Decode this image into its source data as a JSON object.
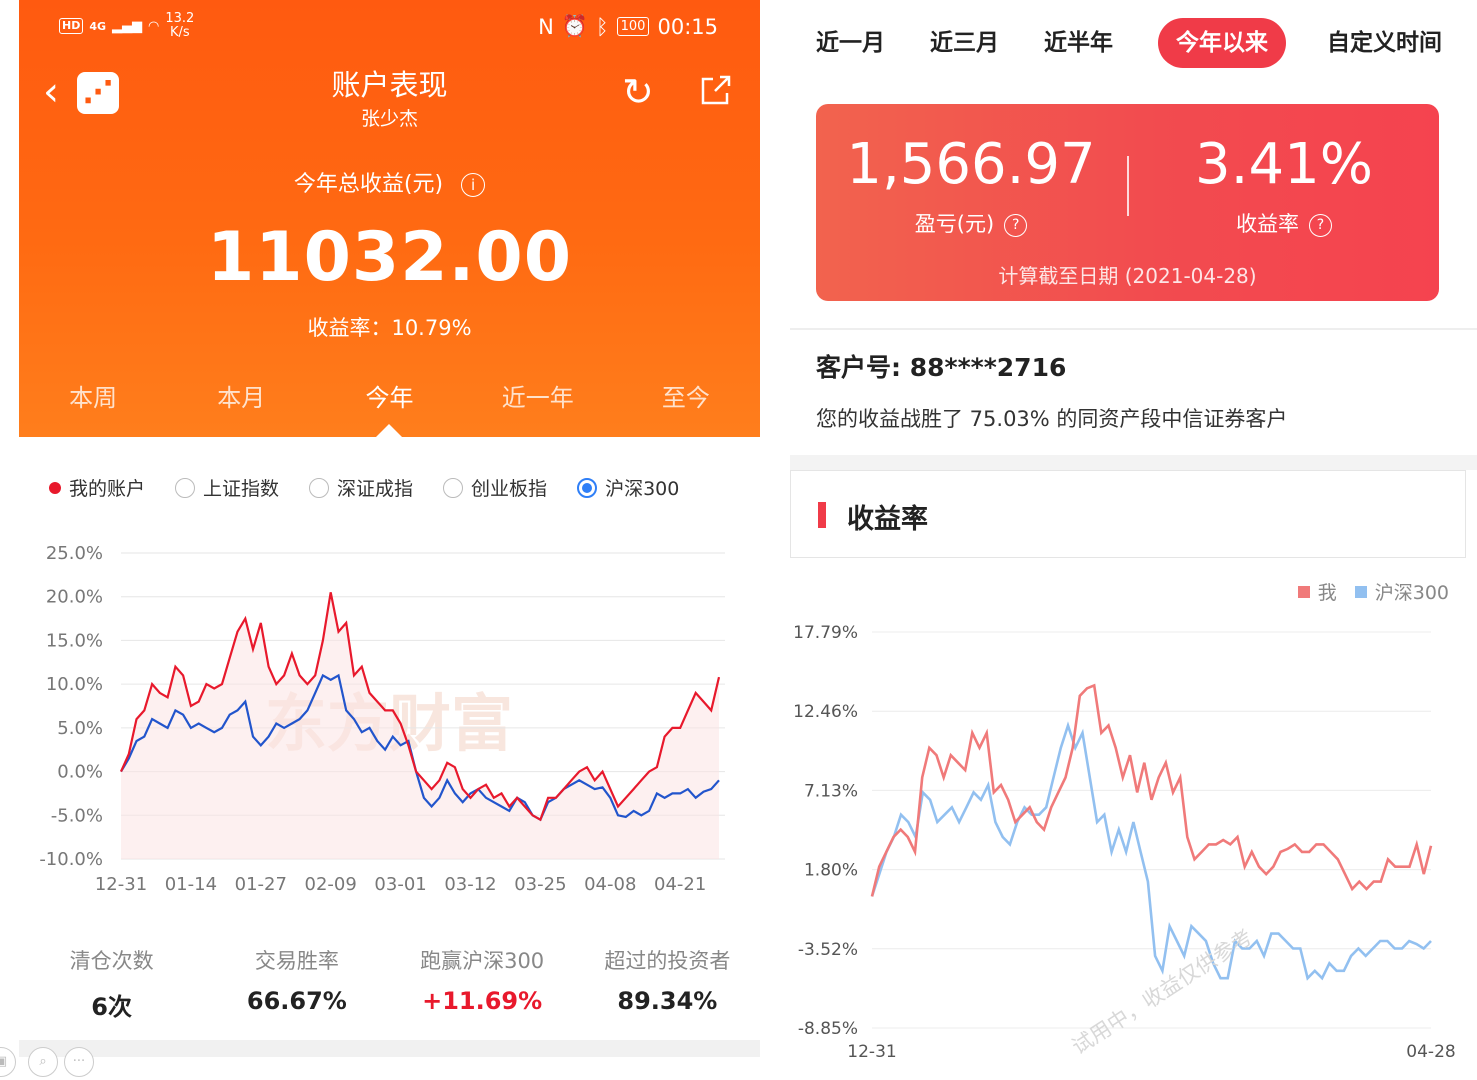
{
  "status_bar": {
    "left_badges": [
      "HD",
      "4G"
    ],
    "speed": "13.2",
    "speed_unit": "K/s",
    "battery": "100",
    "time": "00:15"
  },
  "left": {
    "header": {
      "title": "账户表现",
      "subtitle": "张少杰",
      "total_label": "今年总收益(元)",
      "total_value": "11032.00",
      "rate_text": "收益率：10.79%",
      "info_icon": "i"
    },
    "period_tabs": [
      {
        "label": "本周",
        "active": false
      },
      {
        "label": "本月",
        "active": false
      },
      {
        "label": "今年",
        "active": true
      },
      {
        "label": "近一年",
        "active": false
      },
      {
        "label": "至今",
        "active": false
      }
    ],
    "legend": [
      {
        "label": "我的账户",
        "type": "dot",
        "color": "#e8192c"
      },
      {
        "label": "上证指数",
        "type": "radio",
        "checked": false
      },
      {
        "label": "深证成指",
        "type": "radio",
        "checked": false
      },
      {
        "label": "创业板指",
        "type": "radio",
        "checked": false
      },
      {
        "label": "沪深300",
        "type": "radio",
        "checked": true
      }
    ],
    "watermark": "东方财富",
    "stats": [
      {
        "label": "清仓次数",
        "value": "6次",
        "highlight": false
      },
      {
        "label": "交易胜率",
        "value": "66.67%",
        "highlight": false
      },
      {
        "label": "跑赢沪深300",
        "value": "+11.69%",
        "highlight": true
      },
      {
        "label": "超过的投资者",
        "value": "89.34%",
        "highlight": false
      }
    ]
  },
  "right": {
    "tabs": [
      {
        "label": "近一月",
        "active": false
      },
      {
        "label": "近三月",
        "active": false
      },
      {
        "label": "近半年",
        "active": false
      },
      {
        "label": "今年以来",
        "active": true
      },
      {
        "label": "自定义时间",
        "active": false
      }
    ],
    "card": {
      "profit_value": "1,566.97",
      "profit_label": "盈亏(元)",
      "rate_value": "3.41%",
      "rate_label": "收益率",
      "help_icon": "?",
      "date_text": "计算截至日期 (2021-04-28)"
    },
    "customer": "客户号: 88****2716",
    "beat_text": "您的收益战胜了 75.03% 的同资产段中信证券客户",
    "section_title": "收益率",
    "legend": [
      {
        "label": "我",
        "color": "#f07a7a"
      },
      {
        "label": "沪深300",
        "color": "#92c0f0"
      }
    ],
    "watermark": "试用中，收益仅供参考"
  },
  "chart_data": [
    {
      "type": "line",
      "title": "",
      "x": [
        "12-31",
        "01-04",
        "01-05",
        "01-06",
        "01-07",
        "01-08",
        "01-11",
        "01-12",
        "01-13",
        "01-14",
        "01-15",
        "01-18",
        "01-19",
        "01-20",
        "01-21",
        "01-22",
        "01-25",
        "01-26",
        "01-27",
        "01-28",
        "01-29",
        "02-01",
        "02-02",
        "02-03",
        "02-04",
        "02-05",
        "02-08",
        "02-09",
        "02-10",
        "02-18",
        "02-19",
        "02-22",
        "02-23",
        "02-24",
        "02-25",
        "02-26",
        "03-01",
        "03-02",
        "03-03",
        "03-04",
        "03-05",
        "03-08",
        "03-09",
        "03-10",
        "03-11",
        "03-12",
        "03-15",
        "03-16",
        "03-17",
        "03-18",
        "03-19",
        "03-22",
        "03-23",
        "03-24",
        "03-25",
        "03-26",
        "03-29",
        "03-30",
        "03-31",
        "04-01",
        "04-02",
        "04-06",
        "04-07",
        "04-08",
        "04-09",
        "04-12",
        "04-13",
        "04-14",
        "04-15",
        "04-16",
        "04-19",
        "04-20",
        "04-21",
        "04-22",
        "04-23",
        "04-26",
        "04-27",
        "04-28"
      ],
      "xticks": [
        "12-31",
        "01-14",
        "01-27",
        "02-09",
        "03-01",
        "03-12",
        "03-25",
        "04-08",
        "04-21"
      ],
      "ylim": [
        -10,
        25
      ],
      "yticks": [
        "25.0%",
        "20.0%",
        "15.0%",
        "10.0%",
        "5.0%",
        "0.0%",
        "-5.0%",
        "-10.0%"
      ],
      "series": [
        {
          "name": "我的账户",
          "color": "#e8192c",
          "values": [
            0,
            2,
            6,
            7,
            10,
            9,
            8.5,
            12,
            11,
            7.5,
            8,
            10,
            9.5,
            10,
            13,
            16,
            17.5,
            14,
            17,
            12,
            10,
            11,
            13.5,
            11,
            10,
            11,
            15,
            20.5,
            16,
            17,
            11,
            12,
            9,
            8,
            7,
            7,
            5.5,
            3,
            0,
            -1,
            -2,
            -1,
            1,
            0.5,
            -2,
            -3,
            -2,
            -1.5,
            -3,
            -2.5,
            -4,
            -3,
            -4,
            -5,
            -5.5,
            -3,
            -3,
            -2,
            -1,
            0,
            0.5,
            -1,
            0,
            -2,
            -4,
            -3,
            -2,
            -1,
            0,
            0.5,
            4,
            5,
            5,
            7,
            9,
            8,
            7,
            10.8
          ]
        },
        {
          "name": "沪深300",
          "color": "#2255cc",
          "values": [
            0,
            1.5,
            3.5,
            4,
            6,
            5.5,
            5,
            7,
            6.5,
            5,
            5.5,
            5,
            4.5,
            5,
            6.5,
            7,
            8,
            4,
            3,
            4,
            5.5,
            5,
            5.5,
            6,
            7,
            9,
            11,
            10.5,
            11,
            7,
            6,
            4.5,
            5,
            3.5,
            2.5,
            4,
            3,
            3.5,
            0,
            -3,
            -4,
            -3,
            -1,
            -2.5,
            -3.5,
            -2.5,
            -2,
            -3,
            -3.5,
            -4,
            -4.5,
            -3,
            -3.5,
            -5,
            -5.5,
            -3.5,
            -3,
            -2,
            -1.5,
            -1,
            -1.5,
            -2,
            -1.8,
            -3,
            -5,
            -5.2,
            -4.5,
            -5,
            -4.5,
            -2.5,
            -3,
            -2.5,
            -2.5,
            -2,
            -3,
            -2.3,
            -2,
            -1
          ]
        }
      ]
    },
    {
      "type": "line",
      "title": "收益率",
      "xlabels": [
        "12-31",
        "04-28"
      ],
      "ylim": [
        -8.85,
        17.79
      ],
      "yticks": [
        "17.79%",
        "12.46%",
        "7.13%",
        "1.80%",
        "-3.52%",
        "-8.85%"
      ],
      "series": [
        {
          "name": "我",
          "color": "#f07a7a",
          "values": [
            0,
            2,
            3,
            4,
            4.5,
            4,
            3,
            8,
            10,
            9.5,
            8,
            9.5,
            9,
            8.5,
            11,
            10,
            11,
            7,
            7.5,
            6.5,
            5,
            5.5,
            6,
            5,
            4.5,
            6,
            7,
            8,
            10,
            13.5,
            14,
            14.2,
            11,
            11.5,
            10,
            8,
            9.5,
            7,
            9,
            6.5,
            8,
            9,
            7,
            8,
            4,
            2.5,
            3,
            3.5,
            3.5,
            3.8,
            3.5,
            4,
            2,
            3,
            2,
            1.5,
            2,
            3,
            3.2,
            3.5,
            3,
            3,
            3.5,
            3.5,
            3,
            2.5,
            1.5,
            0.5,
            1,
            0.5,
            1,
            1,
            2.5,
            2,
            2,
            2,
            3.5,
            1.5,
            3.41
          ]
        },
        {
          "name": "沪深300",
          "color": "#92c0f0",
          "values": [
            0,
            1.5,
            3,
            4,
            5.5,
            5,
            4,
            7,
            6.5,
            5,
            5.5,
            6,
            5,
            6,
            7,
            6.5,
            7.5,
            5,
            4,
            3.5,
            5,
            6,
            5.5,
            5.5,
            6,
            8,
            10,
            11.5,
            10,
            11,
            8,
            5,
            5.5,
            3,
            4.5,
            3,
            5,
            3,
            1,
            -4,
            -5,
            -2,
            -3,
            -4,
            -2,
            -2.5,
            -3,
            -4.5,
            -5.5,
            -5.5,
            -3,
            -3.5,
            -3.5,
            -3,
            -4,
            -2.5,
            -2.5,
            -3,
            -3.5,
            -3.5,
            -5.5,
            -5,
            -5.5,
            -4.5,
            -5,
            -5,
            -4,
            -3.5,
            -4,
            -3.5,
            -3,
            -3,
            -3.5,
            -3.5,
            -3,
            -3.2,
            -3.5,
            -3
          ]
        }
      ]
    }
  ]
}
